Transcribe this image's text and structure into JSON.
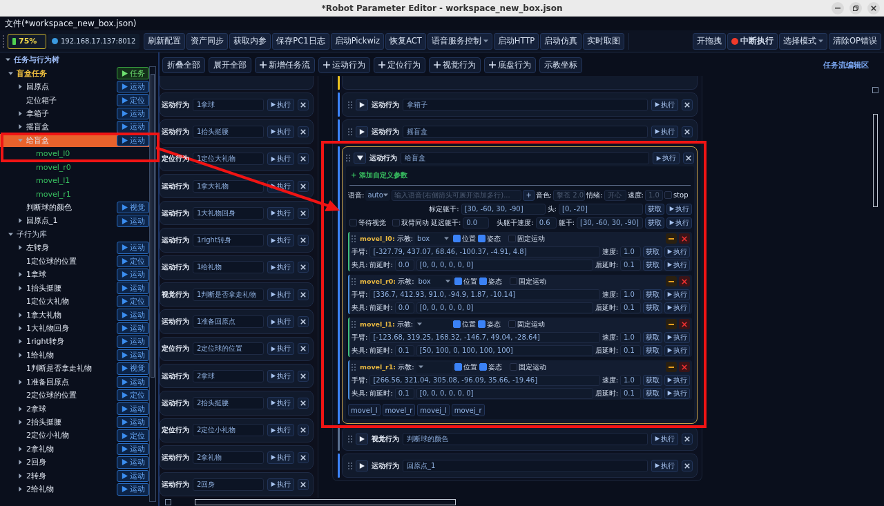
{
  "window": {
    "title": "*Robot Parameter Editor - workspace_new_box.json"
  },
  "menu": {
    "file": "文件(*workspace_new_box.json)"
  },
  "toolbar": {
    "battery": "75%",
    "address": "192.168.17.137:8012",
    "buttons": [
      {
        "label": "刷新配置",
        "kind": "plain"
      },
      {
        "label": "资产同步",
        "kind": "plain"
      },
      {
        "label": "获取内参",
        "kind": "plain"
      },
      {
        "label": "保存PC1日志",
        "kind": "plain"
      },
      {
        "label": "启动Pickwiz",
        "kind": "plain"
      },
      {
        "label": "恢复ACT",
        "kind": "plain"
      },
      {
        "label": "语音服务控制",
        "kind": "dropdown"
      },
      {
        "label": "启动HTTP",
        "kind": "plain"
      },
      {
        "label": "启动仿真",
        "kind": "plain"
      },
      {
        "label": "实时取图",
        "kind": "plain"
      }
    ],
    "right_buttons": [
      {
        "label": "开拖拽",
        "kind": "plain"
      },
      {
        "label": "中断执行",
        "kind": "stop"
      },
      {
        "label": "选择模式",
        "kind": "dropdown"
      },
      {
        "label": "清除OP错误",
        "kind": "plain"
      }
    ]
  },
  "tree": {
    "label": "任务与行为树",
    "kind": "root",
    "expanded": true,
    "selected": false,
    "children": [
      {
        "label": "盲盒任务",
        "kind": "task",
        "expanded": true,
        "selected": false,
        "badge": {
          "text": "任务",
          "kind": "task"
        },
        "children": [
          {
            "label": "回原点",
            "kind": "behavior",
            "expanded": false,
            "selected": false,
            "badge": {
              "text": "运动",
              "kind": "action"
            }
          },
          {
            "label": "定位箱子",
            "kind": "behavior",
            "selected": false,
            "badge": {
              "text": "定位",
              "kind": "action"
            }
          },
          {
            "label": "拿箱子",
            "kind": "behavior",
            "expanded": false,
            "selected": false,
            "badge": {
              "text": "运动",
              "kind": "action"
            }
          },
          {
            "label": "摇盲盒",
            "kind": "behavior",
            "expanded": false,
            "selected": false,
            "badge": {
              "text": "运动",
              "kind": "action"
            }
          },
          {
            "label": "给盲盒",
            "kind": "behavior",
            "expanded": true,
            "selected": true,
            "badge": {
              "text": "运动",
              "kind": "action"
            },
            "children": [
              {
                "label": "movel_l0",
                "kind": "step",
                "selected": false
              },
              {
                "label": "movel_r0",
                "kind": "step",
                "selected": false
              },
              {
                "label": "movel_l1",
                "kind": "step",
                "selected": false
              },
              {
                "label": "movel_r1",
                "kind": "step",
                "selected": false
              }
            ]
          },
          {
            "label": "判断球的颜色",
            "kind": "behavior",
            "selected": false,
            "badge": {
              "text": "视觉",
              "kind": "action"
            }
          },
          {
            "label": "回原点_1",
            "kind": "behavior",
            "expanded": false,
            "selected": false,
            "badge": {
              "text": "运动",
              "kind": "action"
            }
          }
        ]
      },
      {
        "label": "子行为库",
        "kind": "group",
        "expanded": true,
        "selected": false,
        "children": [
          {
            "label": "左转身",
            "kind": "behavior",
            "expanded": false,
            "selected": false,
            "badge": {
              "text": "运动",
              "kind": "action"
            }
          },
          {
            "label": "1定位球的位置",
            "kind": "behavior",
            "selected": false,
            "badge": {
              "text": "定位",
              "kind": "action"
            }
          },
          {
            "label": "1拿球",
            "kind": "behavior",
            "expanded": false,
            "selected": false,
            "badge": {
              "text": "运动",
              "kind": "action"
            }
          },
          {
            "label": "1抬头挺腰",
            "kind": "behavior",
            "expanded": false,
            "selected": false,
            "badge": {
              "text": "运动",
              "kind": "action"
            }
          },
          {
            "label": "1定位大礼物",
            "kind": "behavior",
            "selected": false,
            "badge": {
              "text": "定位",
              "kind": "action"
            }
          },
          {
            "label": "1拿大礼物",
            "kind": "behavior",
            "expanded": false,
            "selected": false,
            "badge": {
              "text": "运动",
              "kind": "action"
            }
          },
          {
            "label": "1大礼物回身",
            "kind": "behavior",
            "expanded": false,
            "selected": false,
            "badge": {
              "text": "运动",
              "kind": "action"
            }
          },
          {
            "label": "1right转身",
            "kind": "behavior",
            "expanded": false,
            "selected": false,
            "badge": {
              "text": "运动",
              "kind": "action"
            }
          },
          {
            "label": "1给礼物",
            "kind": "behavior",
            "expanded": false,
            "selected": false,
            "badge": {
              "text": "运动",
              "kind": "action"
            }
          },
          {
            "label": "1判断是否拿走礼物",
            "kind": "behavior",
            "selected": false,
            "badge": {
              "text": "视觉",
              "kind": "action"
            }
          },
          {
            "label": "1准备回原点",
            "kind": "behavior",
            "expanded": false,
            "selected": false,
            "badge": {
              "text": "运动",
              "kind": "action"
            }
          },
          {
            "label": "2定位球的位置",
            "kind": "behavior",
            "selected": false,
            "badge": {
              "text": "定位",
              "kind": "action"
            }
          },
          {
            "label": "2拿球",
            "kind": "behavior",
            "expanded": false,
            "selected": false,
            "badge": {
              "text": "运动",
              "kind": "action"
            }
          },
          {
            "label": "2抬头挺腰",
            "kind": "behavior",
            "expanded": false,
            "selected": false,
            "badge": {
              "text": "运动",
              "kind": "action"
            }
          },
          {
            "label": "2定位小礼物",
            "kind": "behavior",
            "selected": false,
            "badge": {
              "text": "定位",
              "kind": "action"
            }
          },
          {
            "label": "2拿礼物",
            "kind": "behavior",
            "expanded": false,
            "selected": false,
            "badge": {
              "text": "运动",
              "kind": "action"
            }
          },
          {
            "label": "2回身",
            "kind": "behavior",
            "expanded": false,
            "selected": false,
            "badge": {
              "text": "运动",
              "kind": "action"
            }
          },
          {
            "label": "2转身",
            "kind": "behavior",
            "expanded": false,
            "selected": false,
            "badge": {
              "text": "运动",
              "kind": "action"
            }
          },
          {
            "label": "2给礼物",
            "kind": "behavior",
            "expanded": false,
            "selected": false,
            "badge": {
              "text": "运动",
              "kind": "action"
            }
          }
        ]
      }
    ]
  },
  "flow_toolbar": {
    "buttons": [
      {
        "label": "折叠全部",
        "kind": "plain"
      },
      {
        "label": "展开全部",
        "kind": "plain"
      },
      {
        "label": "新增任务流",
        "kind": "add"
      },
      {
        "label": "运动行为",
        "kind": "add"
      },
      {
        "label": "定位行为",
        "kind": "add"
      },
      {
        "label": "视觉行为",
        "kind": "add"
      },
      {
        "label": "底盘行为",
        "kind": "add"
      },
      {
        "label": "示教坐标",
        "kind": "plain"
      }
    ],
    "title": "任务流编辑区"
  },
  "library_column": [
    {
      "type": "运动行为",
      "name": "1拿球",
      "run": "执行"
    },
    {
      "type": "运动行为",
      "name": "1抬头挺腰",
      "run": "执行"
    },
    {
      "type": "定位行为",
      "name": "1定位大礼物",
      "run": "执行"
    },
    {
      "type": "运动行为",
      "name": "1拿大礼物",
      "run": "执行"
    },
    {
      "type": "运动行为",
      "name": "1大礼物回身",
      "run": "执行"
    },
    {
      "type": "运动行为",
      "name": "1right转身",
      "run": "执行"
    },
    {
      "type": "运动行为",
      "name": "1给礼物",
      "run": "执行"
    },
    {
      "type": "视觉行为",
      "name": "1判断是否拿走礼物",
      "run": "执行"
    },
    {
      "type": "运动行为",
      "name": "1准备回原点",
      "run": "执行"
    },
    {
      "type": "定位行为",
      "name": "2定位球的位置",
      "run": "执行"
    },
    {
      "type": "运动行为",
      "name": "2拿球",
      "run": "执行"
    },
    {
      "type": "运动行为",
      "name": "2抬头挺腰",
      "run": "执行"
    },
    {
      "type": "定位行为",
      "name": "2定位小礼物",
      "run": "执行"
    },
    {
      "type": "运动行为",
      "name": "2拿礼物",
      "run": "执行"
    },
    {
      "type": "运动行为",
      "name": "2回身",
      "run": "执行"
    }
  ],
  "flow_column": [
    {
      "type": "运动行为",
      "kind": "motion",
      "name": "拿箱子",
      "expanded": false,
      "run": "执行"
    },
    {
      "type": "运动行为",
      "kind": "motion",
      "name": "摇盲盒",
      "expanded": false,
      "run": "执行"
    },
    {
      "type": "运动行为",
      "kind": "motion",
      "name": "给盲盒",
      "expanded": true,
      "run": "执行",
      "detail": {
        "add_param": "+ 添加自定义参数",
        "voice": {
          "label": "语音:",
          "mode": "auto",
          "placeholder": "输入语音(右侧箭头可展开添加多行)...",
          "add": "+",
          "timbre_label": "音色:",
          "timbre_placeholder": "擎苍 2.0",
          "emotion_label": "情绪:",
          "emotion_placeholder": "开心",
          "speed_label": "速度:",
          "speed_placeholder": "1.0",
          "stop": {
            "label": "stop",
            "checked": false
          }
        },
        "calib": {
          "torso_label": "标定躯干:",
          "torso": "[30, -60, 30, -90]",
          "head_label": "头:",
          "head": "[0, -20]",
          "fetch": "获取",
          "run": "执行"
        },
        "options": {
          "wait_vision": {
            "label": "等待视觉",
            "checked": false
          },
          "dual_arm": {
            "label": "双臂同动",
            "checked": false
          },
          "delay_label": "延迟躯干:",
          "delay": "0.0",
          "head_speed_label": "头躯干速度:",
          "head_speed": "0.6",
          "torso_label": "躯干:",
          "torso": "[30, -60, 30, -90]",
          "fetch": "获取",
          "run": "执行"
        },
        "moves": [
          {
            "name": "movel_l0:",
            "color": "#3fbf7f",
            "teach_label": "示教:",
            "teach": "box",
            "position": {
              "label": "位置",
              "checked": true
            },
            "pose": {
              "label": "姿态",
              "checked": true
            },
            "fixed": {
              "label": "固定运动",
              "checked": false
            },
            "arm_label": "手臂:",
            "arm": "[-327.79, 437.07, 68.46, -100.37, -4.91, 4.8]",
            "speed_label": "速度:",
            "speed": "1.0",
            "arm_fetch": "获取",
            "arm_run": "执行",
            "grip_label": "夹具:",
            "pre_label": "前延时:",
            "pre": "0.0",
            "grip": "[0, 0, 0, 0, 0, 0]",
            "post_label": "后延时:",
            "post": "0.1",
            "grip_fetch": "获取",
            "grip_run": "执行"
          },
          {
            "name": "movel_r0:",
            "color": "#4a8fe0",
            "teach_label": "示教:",
            "teach": "box",
            "position": {
              "label": "位置",
              "checked": true
            },
            "pose": {
              "label": "姿态",
              "checked": true
            },
            "fixed": {
              "label": "固定运动",
              "checked": false
            },
            "arm_label": "手臂:",
            "arm": "[336.7, 412.93, 91.0, -94.9, 1.87, -10.14]",
            "speed_label": "速度:",
            "speed": "1.0",
            "arm_fetch": "获取",
            "arm_run": "执行",
            "grip_label": "夹具:",
            "pre_label": "前延时:",
            "pre": "0.0",
            "grip": "[0, 0, 0, 0, 0, 0]",
            "post_label": "后延时:",
            "post": "0.1",
            "grip_fetch": "获取",
            "grip_run": "执行"
          },
          {
            "name": "movel_l1:",
            "color": "#3fbf7f",
            "teach_label": "示教:",
            "position": {
              "label": "位置",
              "checked": true
            },
            "pose": {
              "label": "姿态",
              "checked": true
            },
            "fixed": {
              "label": "固定运动",
              "checked": false
            },
            "arm_label": "手臂:",
            "arm": "[-123.68, 319.25, 168.32, -146.7, 49.04, -28.64]",
            "speed_label": "速度:",
            "speed": "1.0",
            "arm_fetch": "获取",
            "arm_run": "执行",
            "grip_label": "夹具:",
            "pre_label": "前延时:",
            "pre": "0.1",
            "grip": "[50, 100, 0, 100, 100, 100]",
            "post_label": "后延时:",
            "post": "0.1",
            "grip_fetch": "获取",
            "grip_run": "执行"
          },
          {
            "name": "movel_r1:",
            "color": "#4a8fe0",
            "teach_label": "示教:",
            "position": {
              "label": "位置",
              "checked": true
            },
            "pose": {
              "label": "姿态",
              "checked": true
            },
            "fixed": {
              "label": "固定运动",
              "checked": false
            },
            "arm_label": "手臂:",
            "arm": "[266.56, 321.04, 305.08, -96.09, 35.66, -19.46]",
            "speed_label": "速度:",
            "speed": "1.0",
            "arm_fetch": "获取",
            "arm_run": "执行",
            "grip_label": "夹具:",
            "pre_label": "前延时:",
            "pre": "0.1",
            "grip": "[0, 0, 0, 0, 0, 0]",
            "post_label": "后延时:",
            "post": "0.1",
            "grip_fetch": "获取",
            "grip_run": "执行"
          }
        ],
        "tags": [
          "movel_l",
          "movel_r",
          "movej_l",
          "movej_r"
        ]
      }
    },
    {
      "type": "视觉行为",
      "kind": "vision",
      "name": "判断球的颜色",
      "expanded": false,
      "run": "执行"
    },
    {
      "type": "运动行为",
      "kind": "motion",
      "name": "回原点_1",
      "expanded": false,
      "run": "执行"
    }
  ]
}
